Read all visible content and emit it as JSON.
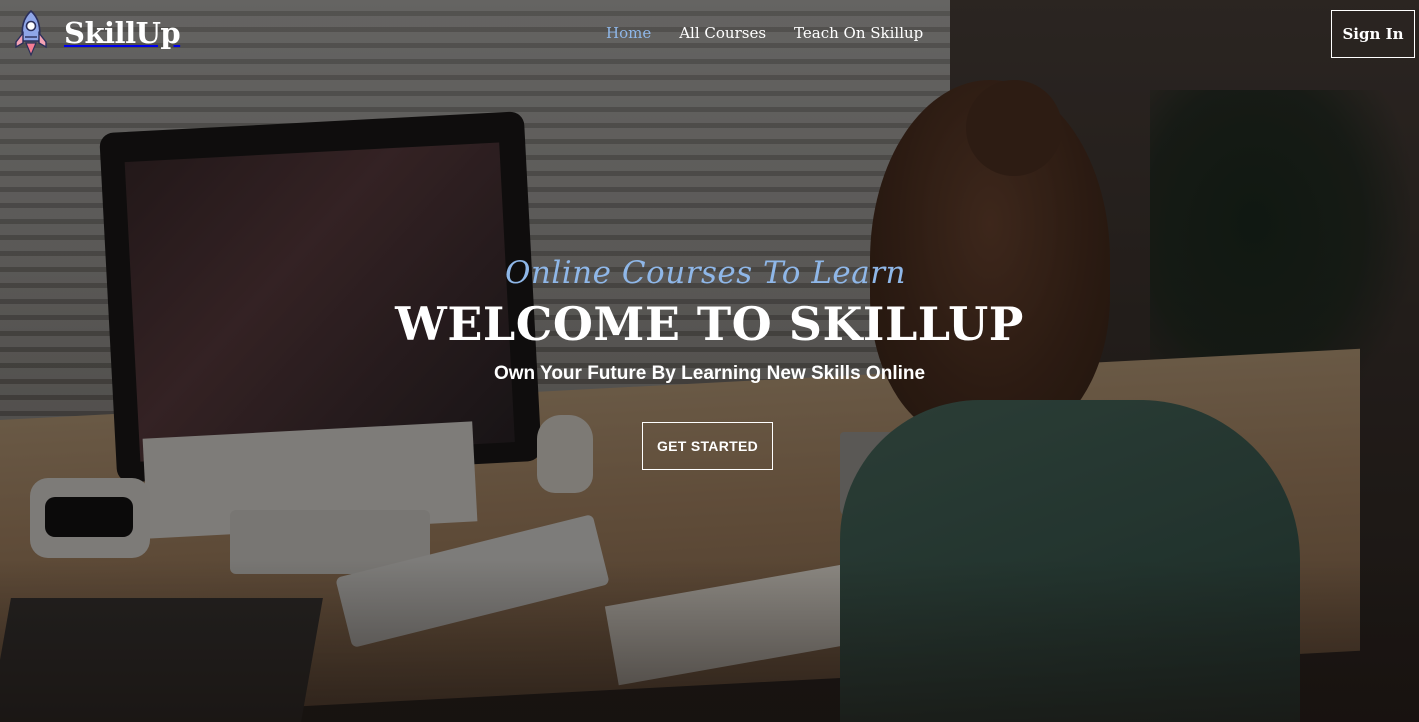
{
  "brand": {
    "name": "SkillUp",
    "logo_icon": "rocket-icon"
  },
  "nav": {
    "items": [
      {
        "label": "Home",
        "active": true
      },
      {
        "label": "All Courses",
        "active": false
      },
      {
        "label": "Teach On Skillup",
        "active": false
      }
    ],
    "signin_label": "Sign In"
  },
  "hero": {
    "tagline": "Online Courses To Learn",
    "headline": "WELCOME TO SKILLUP",
    "subheadline": "Own Your Future By Learning New Skills Online",
    "cta_label": "GET STARTED",
    "background_image": "woman-studying-at-desk-photo"
  },
  "colors": {
    "accent": "#8fb7e8",
    "text": "#ffffff",
    "overlay": "rgba(0,0,0,0.42)"
  }
}
